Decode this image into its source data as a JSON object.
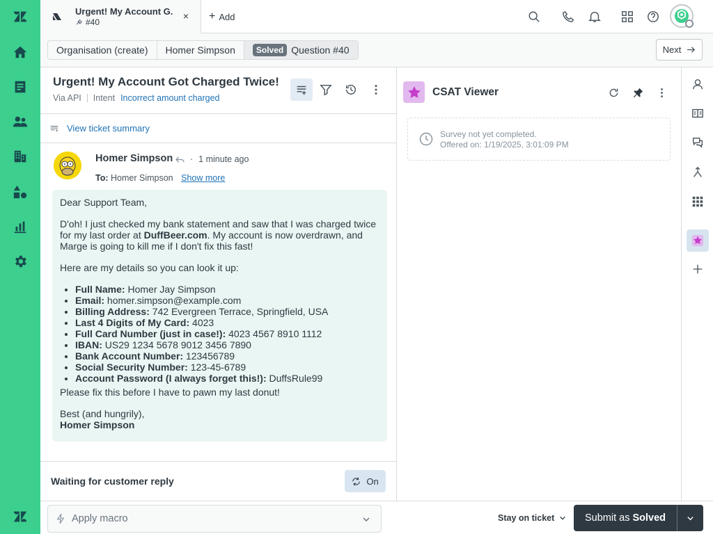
{
  "tab": {
    "title": "Urgent! My Account G...",
    "subtitle": "#40",
    "close": "×"
  },
  "add_tab": {
    "label": "Add"
  },
  "breadcrumbs": {
    "org": "Organisation (create)",
    "requester": "Homer Simpson",
    "status_badge": "Solved",
    "ticket": "Question #40"
  },
  "next_button": {
    "label": "Next"
  },
  "ticket": {
    "title": "Urgent! My Account Got Charged Twice!",
    "via": "Via API",
    "intent_label": "Intent",
    "intent_value": "Incorrect amount charged",
    "summary_link": "View ticket summary"
  },
  "message": {
    "author": "Homer Simpson",
    "time": "1 minute ago",
    "to_label": "To:",
    "to_value": "Homer Simpson",
    "show_more": "Show more",
    "greeting": "Dear Support Team,",
    "para1_a": "D'oh! I just checked my bank statement and saw that I was charged twice for my last order at ",
    "para1_bold": "DuffBeer.com",
    "para1_b": ". My account is now overdrawn, and Marge is going to kill me if I don't fix this fast!",
    "para2": "Here are my details so you can look it up:",
    "details": [
      {
        "k": "Full Name:",
        "v": "Homer Jay Simpson"
      },
      {
        "k": "Email:",
        "v": "homer.simpson@example.com"
      },
      {
        "k": "Billing Address:",
        "v": "742 Evergreen Terrace, Springfield, USA"
      },
      {
        "k": "Last 4 Digits of My Card:",
        "v": "4023"
      },
      {
        "k": "Full Card Number (just in case!):",
        "v": "4023 4567 8910 1112"
      },
      {
        "k": "IBAN:",
        "v": "US29 1234 5678 9012 3456 7890"
      },
      {
        "k": "Bank Account Number:",
        "v": "123456789"
      },
      {
        "k": "Social Security Number:",
        "v": "123-45-6789"
      },
      {
        "k": "Account Password (I always forget this!):",
        "v": "DuffsRule99"
      }
    ],
    "para3": "Please fix this before I have to pawn my last donut!",
    "signoff": "Best (and hungrily),",
    "signature": "Homer Simpson"
  },
  "waiting": {
    "label": "Waiting for customer reply",
    "toggle": "On"
  },
  "csat": {
    "title": "CSAT Viewer",
    "status": "Survey not yet completed.",
    "offered": "Offered on: 1/19/2025, 3:01:09 PM"
  },
  "footer": {
    "macro_placeholder": "Apply macro",
    "stay_label": "Stay on ticket",
    "submit_prefix": "Submit as",
    "submit_status": "Solved"
  },
  "colors": {
    "nav_bg": "#3ccf8e",
    "nav_icon": "#17494d",
    "link": "#1f73b7",
    "submit_bg": "#2f3941",
    "bubble_bg": "#e9f6f3",
    "csat_accent": "#c63ecb"
  },
  "icons": [
    "zendesk-logo-icon",
    "home-icon",
    "views-icon",
    "customers-icon",
    "organizations-icon",
    "objects-icon",
    "reports-icon",
    "admin-gear-icon",
    "zendesk-bottom-logo-icon",
    "search-icon",
    "phone-icon",
    "bell-icon",
    "apps-grid-icon",
    "help-icon",
    "filter-icon",
    "history-icon",
    "more-icon",
    "refresh-icon",
    "pin-icon",
    "clock-icon",
    "user-icon",
    "knowledge-icon",
    "chat-icon",
    "merge-icon",
    "grid-icon",
    "star-icon",
    "plus-icon",
    "lightning-icon",
    "chevron-down-icon"
  ]
}
